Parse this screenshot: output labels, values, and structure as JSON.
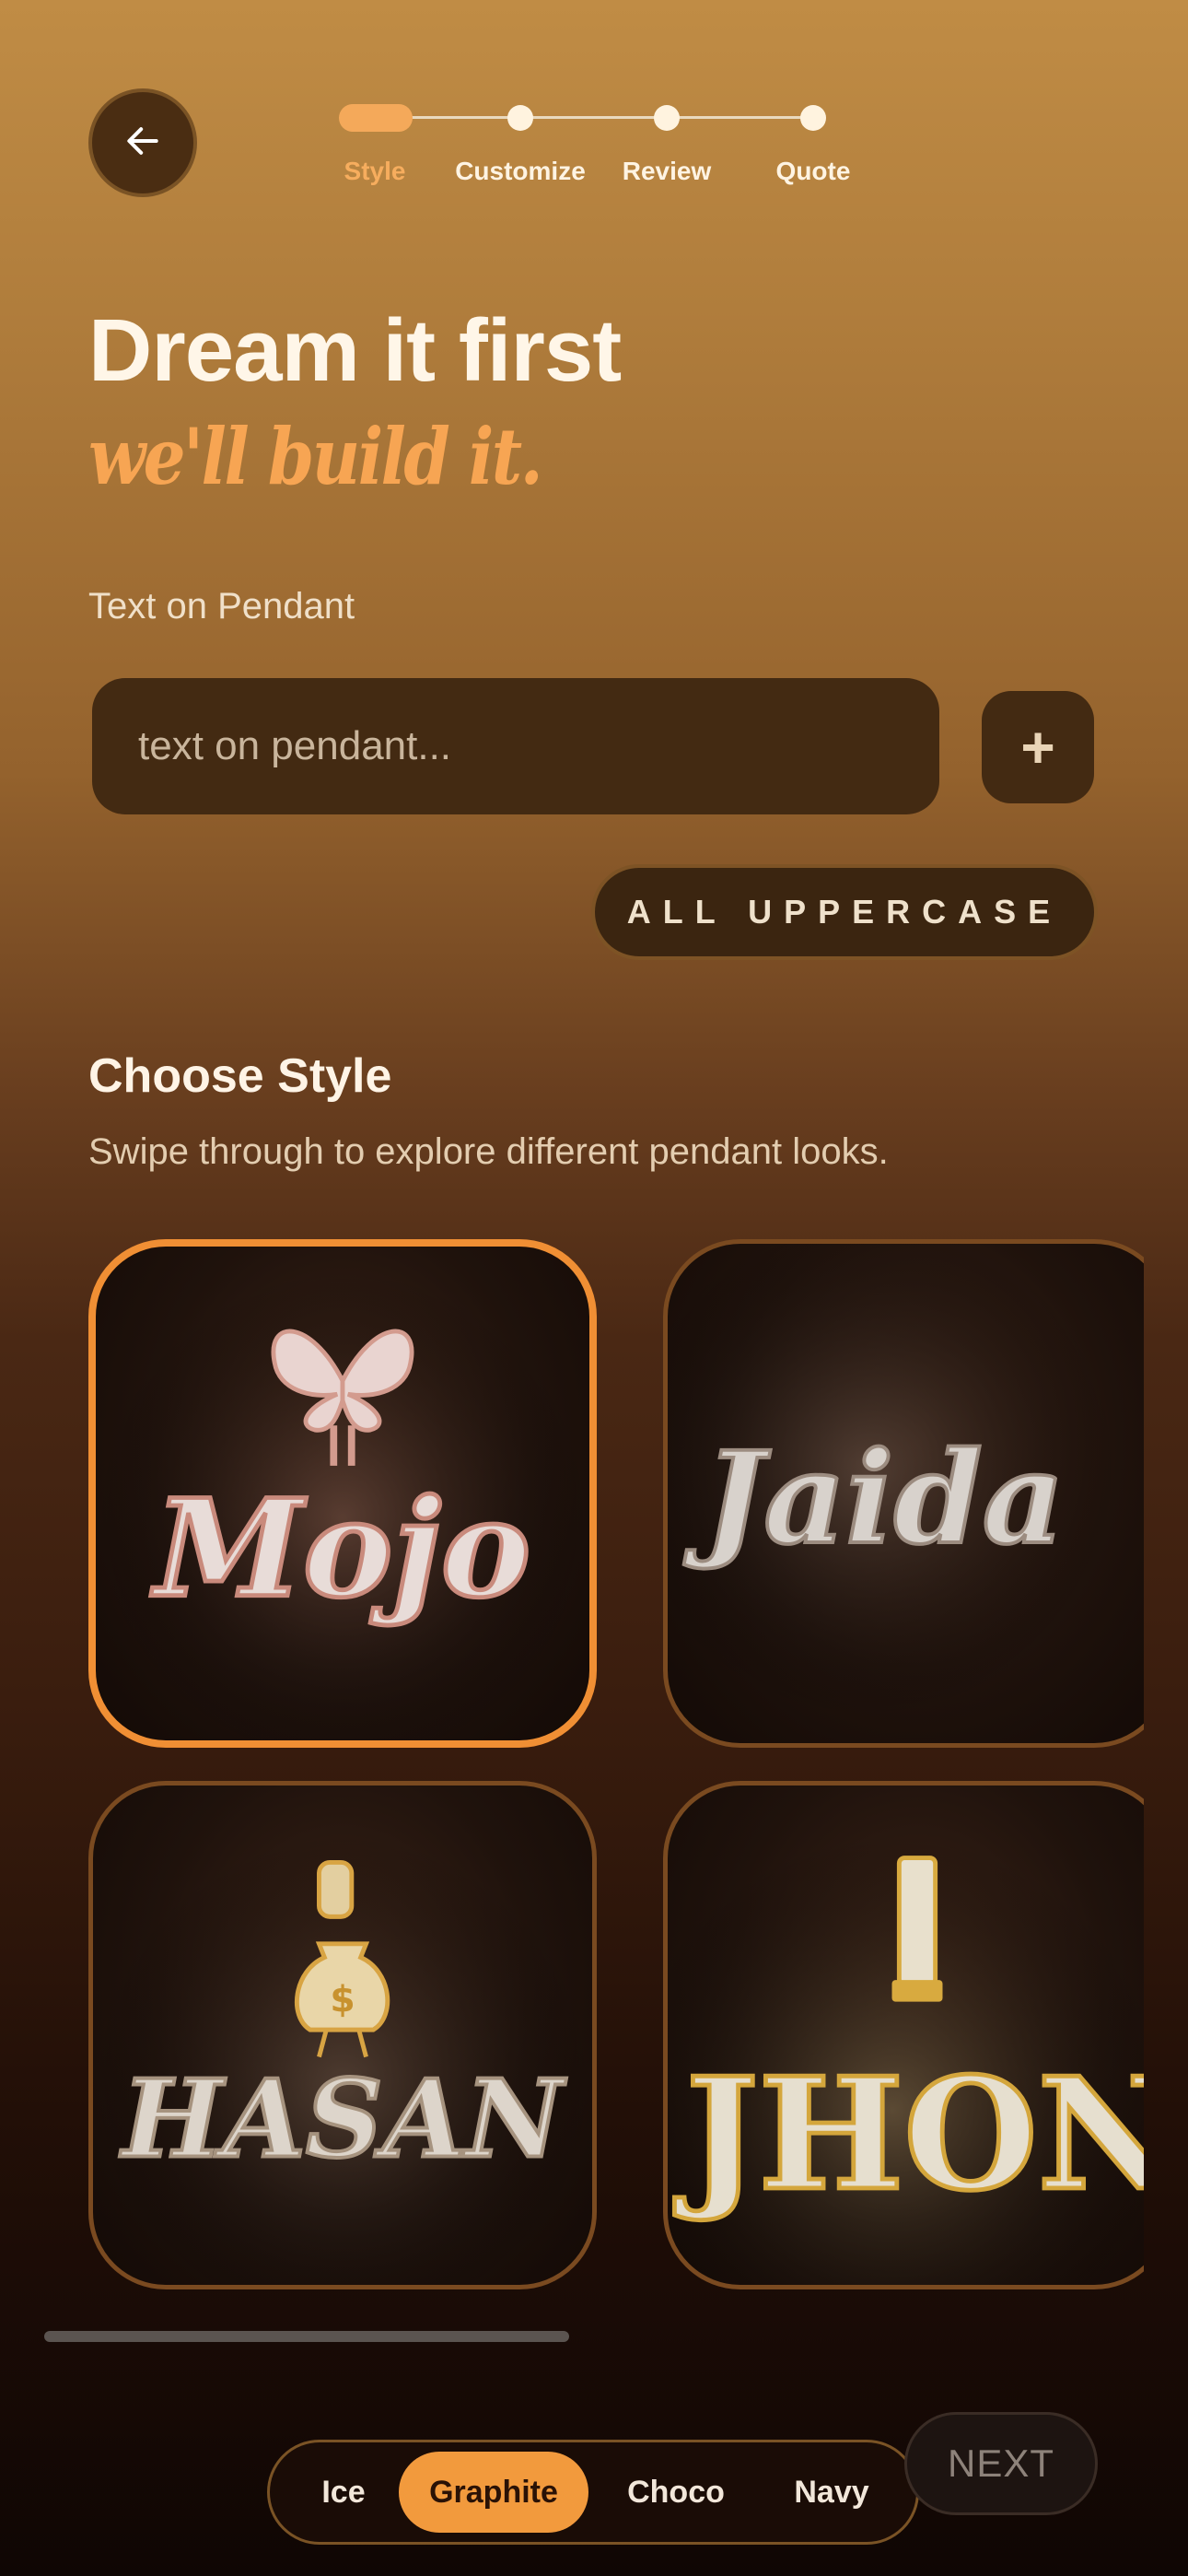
{
  "header": {
    "back_icon": "arrow-left-icon",
    "steps": [
      {
        "label": "Style",
        "active": true
      },
      {
        "label": "Customize",
        "active": false
      },
      {
        "label": "Review",
        "active": false
      },
      {
        "label": "Quote",
        "active": false
      }
    ]
  },
  "hero": {
    "title": "Dream it first",
    "subtitle": "we'll build it."
  },
  "text_field": {
    "label": "Text on Pendant",
    "placeholder": "text on pendant...",
    "value": "",
    "add_icon": "plus-icon",
    "add_label": "+",
    "uppercase_label": "ALL UPPERCASE"
  },
  "styles": {
    "title": "Choose Style",
    "subtitle": "Swipe through to explore different pendant looks.",
    "items": [
      {
        "text": "Mojo",
        "selected": true,
        "metal": "rose",
        "topper": "butterfly"
      },
      {
        "text": "Jaida",
        "selected": false,
        "metal": "silver",
        "topper": "none"
      },
      {
        "text": "HASAN",
        "selected": false,
        "metal": "gold",
        "topper": "money-bag"
      },
      {
        "text": "JHON",
        "selected": false,
        "metal": "gold",
        "topper": "bail"
      }
    ]
  },
  "footer": {
    "themes": [
      {
        "label": "Ice",
        "active": false
      },
      {
        "label": "Graphite",
        "active": true
      },
      {
        "label": "Choco",
        "active": false
      },
      {
        "label": "Navy",
        "active": false
      }
    ],
    "next_label": "NEXT"
  },
  "colors": {
    "accent": "#f29a3d",
    "field_bg": "#432a12",
    "headline_italic": "#f7a553"
  }
}
